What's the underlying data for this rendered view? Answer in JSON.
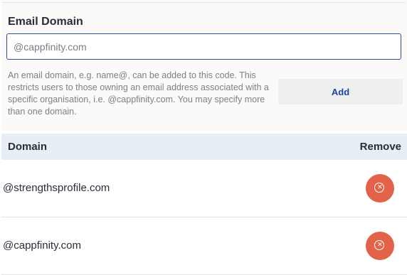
{
  "email_domain": {
    "title": "Email Domain",
    "input_value": "",
    "input_placeholder": "@cappfinity.com",
    "help_text": "An email domain, e.g. name@, can be added to this code. This restricts users to those owning an email address associated with a specific organisation, i.e. @cappfinity.com. You may specify more than one domain.",
    "add_label": "Add"
  },
  "table": {
    "header_domain": "Domain",
    "header_remove": "Remove",
    "rows": [
      {
        "domain": "@strengthsprofile.com"
      },
      {
        "domain": "@cappfinity.com"
      }
    ]
  },
  "icons": {
    "remove_icon": "close-circle-icon",
    "remove_color": "#e2634a"
  },
  "colors": {
    "accent": "#1f43a3",
    "input_border": "#2d4f9a",
    "header_bg": "#e8eef6"
  }
}
